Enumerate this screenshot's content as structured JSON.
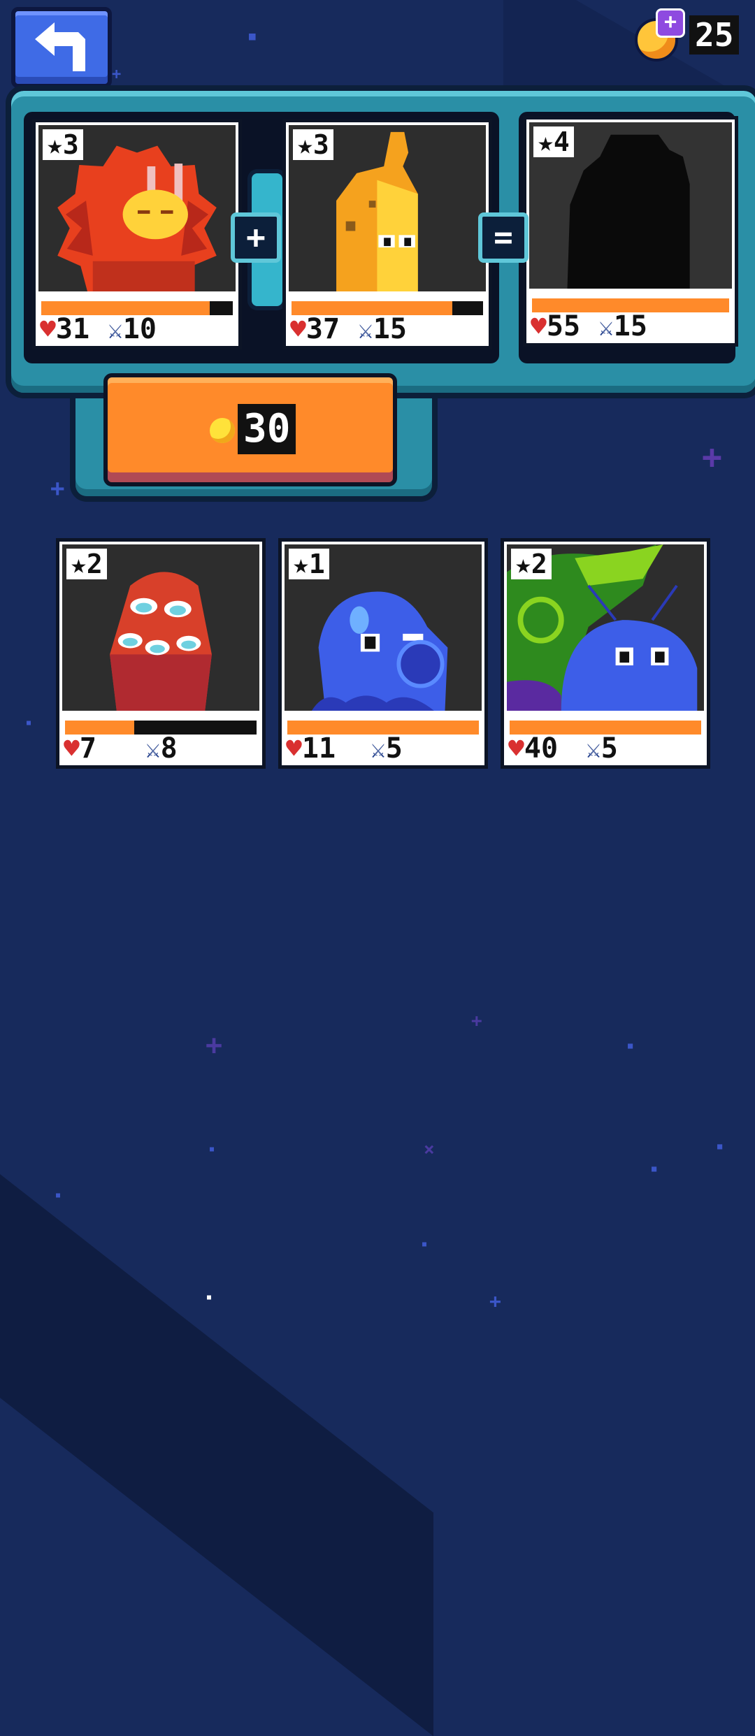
{
  "currency": {
    "value": "25",
    "add_label": "+"
  },
  "fusion": {
    "plus_label": "+",
    "equals_label": "=",
    "buy_price": "30",
    "input_cards": [
      {
        "stars": "★3",
        "hp": "31",
        "attack": "10",
        "hp_fill": 0.88
      },
      {
        "stars": "★3",
        "hp": "37",
        "attack": "15",
        "hp_fill": 0.84
      }
    ],
    "result_card": {
      "stars": "★4",
      "hp": "55",
      "attack": "15",
      "hp_fill": 1.0
    }
  },
  "inventory": [
    {
      "stars": "★2",
      "hp": "7",
      "attack": "8",
      "hp_fill": 0.36
    },
    {
      "stars": "★1",
      "hp": "11",
      "attack": "5",
      "hp_fill": 1.0
    },
    {
      "stars": "★2",
      "hp": "40",
      "attack": "5",
      "hp_fill": 1.0
    }
  ],
  "colors": {
    "background": "#172a5c",
    "machine": "#2a8fa6",
    "button": "#ff8a2a",
    "hp_bar": "#ff8a2a",
    "heart": "#d93030"
  },
  "icons": {
    "back": "back-arrow-icon",
    "gem": "gem-icon",
    "coin": "coin-icon",
    "heart": "heart-icon",
    "sword": "sword-icon"
  }
}
